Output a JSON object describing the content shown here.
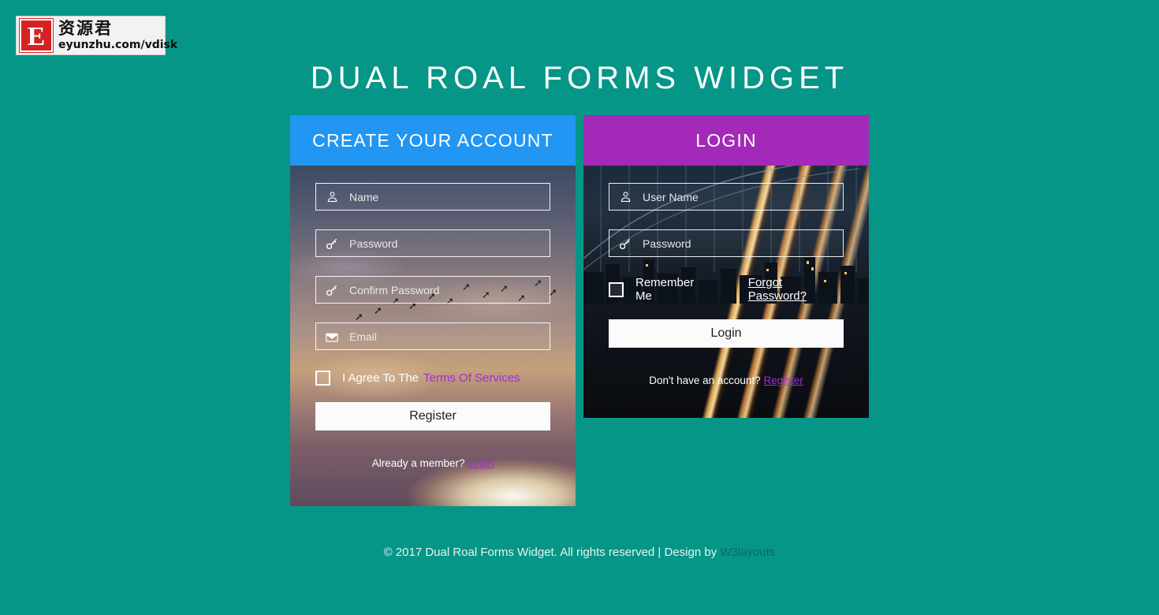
{
  "watermark": {
    "letter": "E",
    "cn_text": "资源君",
    "url_text": "eyunzhu.com/vdisk"
  },
  "header": {
    "title": "DUAL ROAL FORMS WIDGET"
  },
  "colors": {
    "page_background": "#059688",
    "register_header": "#2196f3",
    "login_header": "#a329b8",
    "link_purple": "#a12fcf",
    "button_background": "#fbfbfb"
  },
  "register_panel": {
    "title": "CREATE YOUR ACCOUNT",
    "fields": [
      {
        "icon": "user-icon",
        "placeholder": "Name",
        "value": "",
        "type": "text"
      },
      {
        "icon": "key-icon",
        "placeholder": "Password",
        "value": "",
        "type": "password"
      },
      {
        "icon": "key-icon",
        "placeholder": "Confirm Password",
        "value": "",
        "type": "password"
      },
      {
        "icon": "envelope-icon",
        "placeholder": "Email",
        "value": "",
        "type": "text"
      }
    ],
    "agree_text": "I Agree To The",
    "terms_link": "Terms Of Services",
    "submit_label": "Register",
    "footer_text": "Already a member?",
    "footer_link": "Login"
  },
  "login_panel": {
    "title": "LOGIN",
    "fields": [
      {
        "icon": "user-icon",
        "placeholder": "User Name",
        "value": "",
        "type": "text"
      },
      {
        "icon": "key-icon",
        "placeholder": "Password",
        "value": "",
        "type": "password"
      }
    ],
    "remember_label": "Remember Me",
    "forgot_link": "Forgot Password?",
    "submit_label": "Login",
    "footer_text": "Don't have an account?",
    "footer_link": "Register"
  },
  "footer": {
    "text": "© 2017 Dual Roal Forms Widget. All rights reserved | Design by",
    "link": "W3layouts"
  }
}
